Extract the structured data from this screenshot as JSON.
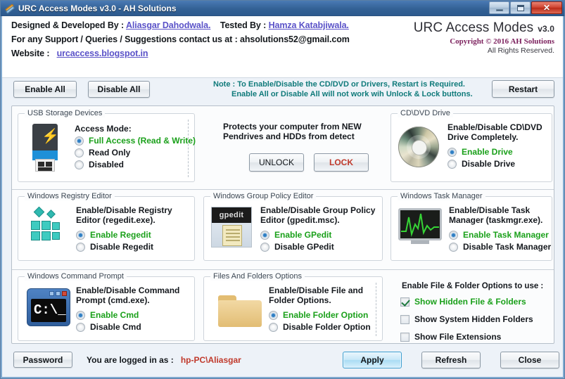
{
  "window": {
    "title": "URC Access Modes v3.0 - AH Solutions",
    "minimize_label": "Minimize",
    "maximize_label": "Maximize",
    "close_label": "✕"
  },
  "header": {
    "credit_prefix": "Designed & Developed By :",
    "developer": "Aliasgar Dahodwala.",
    "tested_prefix": "Tested By :",
    "tester": "Hamza Katabjiwala.",
    "support_line": "For any Support / Queries / Suggestions contact us at :  ahsolutions52@gmail.com",
    "website_prefix": "Website :",
    "website": "urcaccess.blogspot.in",
    "brand": "URC Access Modes",
    "version": "v3.0",
    "copyright": "Copyright © 2016 AH Solutions",
    "rights": "All Rights Reserved."
  },
  "toolbar": {
    "enable_all": "Enable All",
    "disable_all": "Disable All",
    "restart": "Restart",
    "note_line1": "Note : To Enable/Disable the CD/DVD or Drivers, Restart is Required.",
    "note_line2": "Enable All or Disable All will not work wih Unlock & Lock buttons."
  },
  "usb": {
    "group_title": "USB Storage Devices",
    "icon": "usb-drive-icon",
    "heading": "Access Mode:",
    "options": [
      {
        "label": "Full Access (Read & Write)",
        "selected": true
      },
      {
        "label": "Read Only",
        "selected": false
      },
      {
        "label": "Disabled",
        "selected": false
      }
    ]
  },
  "protect": {
    "desc_line1": "Protects your computer from NEW",
    "desc_line2": "Pendrives and HDDs from detect",
    "unlock": "UNLOCK",
    "lock": "LOCK"
  },
  "cddvd": {
    "group_title": "CD\\DVD Drive",
    "icon": "cd-disc-icon",
    "desc_line1": "Enable/Disable CD\\DVD",
    "desc_line2": "Drive Completely.",
    "options": [
      {
        "label": "Enable Drive",
        "selected": true
      },
      {
        "label": "Disable Drive",
        "selected": false
      }
    ]
  },
  "registry": {
    "group_title": "Windows Registry Editor",
    "icon": "registry-blocks-icon",
    "desc_line1": "Enable/Disable Registry",
    "desc_line2": "Editor (regedit.exe).",
    "options": [
      {
        "label": "Enable Regedit",
        "selected": true
      },
      {
        "label": "Disable Regedit",
        "selected": false
      }
    ]
  },
  "gpedit": {
    "group_title": "Windows Group Policy Editor",
    "icon": "gpedit-document-icon",
    "icon_label": "gpedit",
    "desc_line1": "Enable/Disable Group Policy",
    "desc_line2": "Editor (gpedit.msc).",
    "options": [
      {
        "label": "Enable GPedit",
        "selected": true
      },
      {
        "label": "Disable GPedit",
        "selected": false
      }
    ]
  },
  "taskmgr": {
    "group_title": "Windows Task Manager",
    "icon": "task-manager-monitor-icon",
    "desc_line1": "Enable/Disable Task",
    "desc_line2": "Manager (taskmgr.exe).",
    "options": [
      {
        "label": "Enable Task Manager",
        "selected": true
      },
      {
        "label": "Disable Task Manager",
        "selected": false
      }
    ]
  },
  "cmd": {
    "group_title": "Windows Command Prompt",
    "icon": "command-prompt-icon",
    "icon_text": "C:\\_",
    "desc_line1": "Enable/Disable Command",
    "desc_line2": "Prompt (cmd.exe).",
    "options": [
      {
        "label": "Enable Cmd",
        "selected": true
      },
      {
        "label": "Disable Cmd",
        "selected": false
      }
    ]
  },
  "folderopts": {
    "group_title": "Files And Folders Options",
    "icon": "folder-icon",
    "desc_line1": "Enable/Disable File and",
    "desc_line2": "Folder Options.",
    "options": [
      {
        "label": "Enable Folder Option",
        "selected": true
      },
      {
        "label": "Disable Folder Option",
        "selected": false
      }
    ]
  },
  "fileflags": {
    "heading": "Enable File & Folder Options to use :",
    "items": [
      {
        "label": "Show Hidden File & Folders",
        "checked": true
      },
      {
        "label": "Show System Hidden Folders",
        "checked": false
      },
      {
        "label": "Show File Extensions",
        "checked": false
      }
    ]
  },
  "bottom": {
    "password": "Password",
    "logged_prefix": "You are logged in as :",
    "logged_user": "hp-PC\\Aliasgar",
    "apply": "Apply",
    "refresh": "Refresh",
    "close": "Close"
  },
  "colors": {
    "accent_green": "#1aa01a",
    "note_teal": "#0f7a7a",
    "link_purple": "#5a52c8",
    "copyright_magenta": "#7b1f5c",
    "user_red": "#c0392b",
    "titlebar_blue": "#336195"
  }
}
